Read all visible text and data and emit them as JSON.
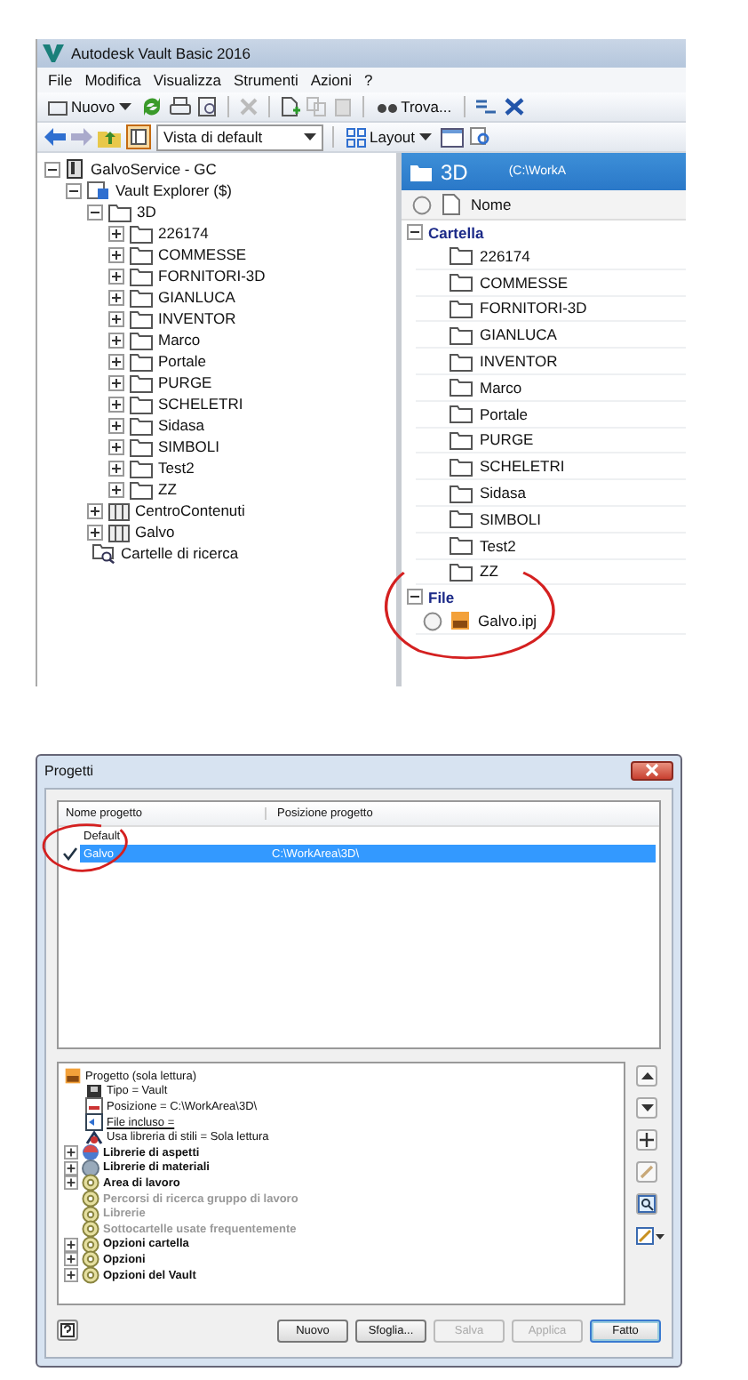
{
  "vault": {
    "title": "Autodesk Vault Basic 2016",
    "menu": [
      "File",
      "Modifica",
      "Visualizza",
      "Strumenti",
      "Azioni",
      "?"
    ],
    "new_button": "Nuovo",
    "find_button": "Trova...",
    "view_select": "Vista di default",
    "layout_button": "Layout",
    "tree": [
      {
        "label": "GalvoService - GC",
        "kind": "server",
        "expanded": true,
        "children": [
          {
            "label": "Vault Explorer ($)",
            "kind": "vault",
            "expanded": true,
            "children": [
              {
                "label": "3D",
                "kind": "folder",
                "expanded": true,
                "children": [
                  {
                    "label": "226174",
                    "kind": "folder",
                    "expanded": false
                  },
                  {
                    "label": "COMMESSE",
                    "kind": "folder",
                    "expanded": false
                  },
                  {
                    "label": "FORNITORI-3D",
                    "kind": "folder",
                    "expanded": false
                  },
                  {
                    "label": "GIANLUCA",
                    "kind": "folder",
                    "expanded": false
                  },
                  {
                    "label": "INVENTOR",
                    "kind": "folder",
                    "expanded": false
                  },
                  {
                    "label": "Marco",
                    "kind": "folder",
                    "expanded": false
                  },
                  {
                    "label": "Portale",
                    "kind": "folder",
                    "expanded": false
                  },
                  {
                    "label": "PURGE",
                    "kind": "folder",
                    "expanded": false
                  },
                  {
                    "label": "SCHELETRI",
                    "kind": "folder",
                    "expanded": false
                  },
                  {
                    "label": "Sidasa",
                    "kind": "folder",
                    "expanded": false
                  },
                  {
                    "label": "SIMBOLI",
                    "kind": "folder",
                    "expanded": false
                  },
                  {
                    "label": "Test2",
                    "kind": "folder",
                    "expanded": false
                  },
                  {
                    "label": "ZZ",
                    "kind": "folder",
                    "expanded": false
                  }
                ]
              },
              {
                "label": "CentroContenuti",
                "kind": "library",
                "expanded": false
              },
              {
                "label": "Galvo",
                "kind": "library",
                "expanded": false
              },
              {
                "label": "Cartelle di ricerca",
                "kind": "search"
              }
            ]
          }
        ]
      }
    ],
    "panel": {
      "title": "3D",
      "path": "(C:\\WorkA",
      "column": "Nome",
      "groups": [
        {
          "label": "Cartella",
          "expanded": true,
          "items": [
            {
              "label": "226174",
              "kind": "folder"
            },
            {
              "label": "COMMESSE",
              "kind": "folder"
            },
            {
              "label": "FORNITORI-3D",
              "kind": "folder"
            },
            {
              "label": "GIANLUCA",
              "kind": "folder"
            },
            {
              "label": "INVENTOR",
              "kind": "folder"
            },
            {
              "label": "Marco",
              "kind": "folder"
            },
            {
              "label": "Portale",
              "kind": "folder"
            },
            {
              "label": "PURGE",
              "kind": "folder"
            },
            {
              "label": "SCHELETRI",
              "kind": "folder"
            },
            {
              "label": "Sidasa",
              "kind": "folder"
            },
            {
              "label": "SIMBOLI",
              "kind": "folder"
            },
            {
              "label": "Test2",
              "kind": "folder"
            },
            {
              "label": "ZZ",
              "kind": "folder"
            }
          ]
        },
        {
          "label": "File",
          "expanded": true,
          "items": [
            {
              "label": "Galvo.ipj",
              "kind": "project"
            }
          ]
        }
      ]
    }
  },
  "dialog": {
    "title": "Progetti",
    "columns": [
      "Nome progetto",
      "Posizione progetto"
    ],
    "projects": [
      {
        "name": "Default",
        "active": false,
        "selected": false
      },
      {
        "name": "Galvo",
        "location": "C:\\WorkArea\\3D\\",
        "active": true,
        "selected": true
      }
    ],
    "settings": [
      {
        "label": "Progetto (sola lettura)",
        "kind": "project",
        "bold": false,
        "disabled": false,
        "children": [
          {
            "label": "Tipo = Vault",
            "kind": "type",
            "bold": false,
            "disabled": false
          },
          {
            "label": "Posizione = C:\\WorkArea\\3D\\",
            "kind": "location",
            "bold": false,
            "disabled": false
          },
          {
            "label": "File incluso =",
            "kind": "file",
            "bold": false,
            "disabled": false,
            "link": true
          },
          {
            "label": "Usa libreria di stili = Sola lettura",
            "kind": "style",
            "bold": false,
            "disabled": false
          }
        ]
      },
      {
        "label": "Librerie di aspetti",
        "kind": "appearance",
        "bold": true,
        "disabled": false,
        "expanded": false
      },
      {
        "label": "Librerie di materiali",
        "kind": "material",
        "bold": true,
        "disabled": false,
        "expanded": false
      },
      {
        "label": "Area di lavoro",
        "kind": "option",
        "bold": true,
        "disabled": false,
        "expanded": false
      },
      {
        "label": "Percorsi di ricerca gruppo di lavoro",
        "kind": "option",
        "bold": true,
        "disabled": true
      },
      {
        "label": "Librerie",
        "kind": "option",
        "bold": true,
        "disabled": true
      },
      {
        "label": "Sottocartelle usate frequentemente",
        "kind": "option",
        "bold": true,
        "disabled": true
      },
      {
        "label": "Opzioni cartella",
        "kind": "option",
        "bold": true,
        "disabled": false,
        "expanded": false
      },
      {
        "label": "Opzioni",
        "kind": "option",
        "bold": true,
        "disabled": false,
        "expanded": false
      },
      {
        "label": "Opzioni del Vault",
        "kind": "option",
        "bold": true,
        "disabled": false,
        "expanded": false
      }
    ],
    "buttons": [
      {
        "label": "Nuovo",
        "disabled": false,
        "default": false
      },
      {
        "label": "Sfoglia...",
        "disabled": false,
        "default": false
      },
      {
        "label": "Salva",
        "disabled": true,
        "default": false
      },
      {
        "label": "Applica",
        "disabled": true,
        "default": false
      },
      {
        "label": "Fatto",
        "disabled": false,
        "default": true
      }
    ]
  }
}
